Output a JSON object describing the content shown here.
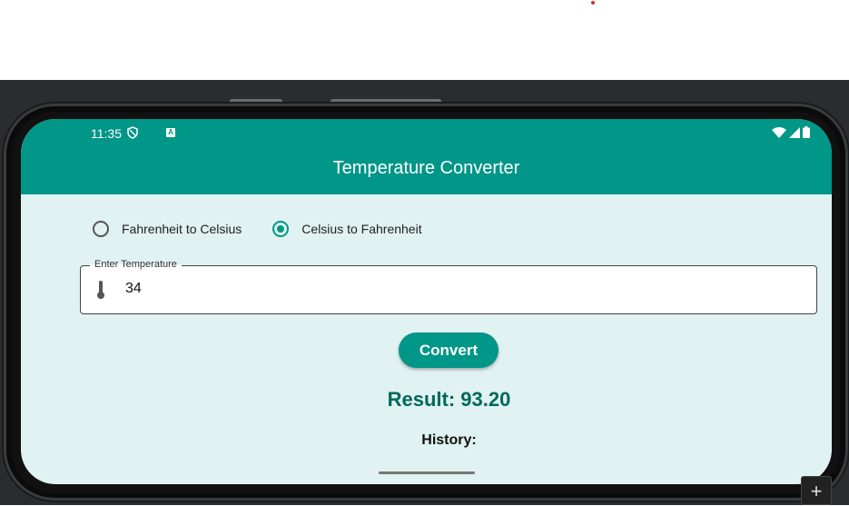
{
  "status_bar": {
    "time": "11:35",
    "icons": [
      "shield-icon",
      "a-notification-icon",
      "wifi-icon",
      "signal-icon",
      "battery-icon"
    ]
  },
  "app_bar": {
    "title": "Temperature Converter",
    "color": "#009688"
  },
  "conversion_options": [
    {
      "label": "Fahrenheit to Celsius",
      "selected": false
    },
    {
      "label": "Celsius to Fahrenheit",
      "selected": true
    }
  ],
  "input": {
    "label": "Enter Temperature",
    "value": "34",
    "icon": "thermometer-icon"
  },
  "convert_button": {
    "label": "Convert"
  },
  "result_text": "Result: 93.20",
  "history_label": "History:",
  "colors": {
    "accent": "#009688",
    "background": "#e0f2f1",
    "result": "#00695c"
  },
  "emulator": {
    "add_button_icon": "plus-icon"
  }
}
